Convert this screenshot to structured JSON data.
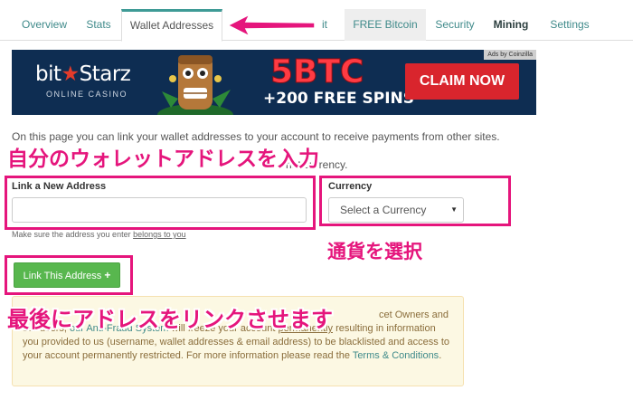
{
  "tabs": [
    {
      "label": "Overview"
    },
    {
      "label": "Stats"
    },
    {
      "label": "Wallet Addresses"
    },
    {
      "label": "it"
    },
    {
      "label": "FREE Bitcoin"
    },
    {
      "label": "Security"
    },
    {
      "label": "Mining"
    },
    {
      "label": "Settings"
    }
  ],
  "banner": {
    "ads_by": "Ads by Coinzilla",
    "brand_prefix": "bit",
    "brand_star": "★",
    "brand_suffix": "Starz",
    "brand_sub": "ONLINE CASINO",
    "headline": "5BTC",
    "subline": "+200 FREE SPINS",
    "cta": "CLAIM NOW"
  },
  "intro": {
    "line1": "On this page you can link your wallet addresses to your account to receive payments from other sites.",
    "line2_end": "hat currency."
  },
  "form": {
    "address_label": "Link a New Address",
    "address_value": "",
    "currency_label": "Currency",
    "currency_selected": "Select a Currency",
    "hint_prefix": "Make sure the address you enter ",
    "hint_link": "belongs to you",
    "submit_label": "Link This Address",
    "submit_icon": "+"
  },
  "warning": {
    "line1_end": "cet Owners and",
    "line2_start": "our users, ",
    "line2_link": "our Anti-Fraud System",
    "line2_mid": " will freeze your account ",
    "line2_ul": "permanently",
    "line2_end": " resulting in information",
    "body": "you provided to us (username, wallet addresses & email address) to be blacklisted and access to your account permanently restricted. For more information please read the ",
    "terms_link": "Terms & Conditions",
    "terms_end": "."
  },
  "annotations": {
    "enter_wallet": "自分のウォレットアドレスを入力",
    "select_currency": "通貨を選択",
    "link_address": "最後にアドレスをリンクさせます"
  },
  "colors": {
    "accent": "#3f9b96",
    "annotation": "#e5157c",
    "button_green": "#58b74e"
  }
}
